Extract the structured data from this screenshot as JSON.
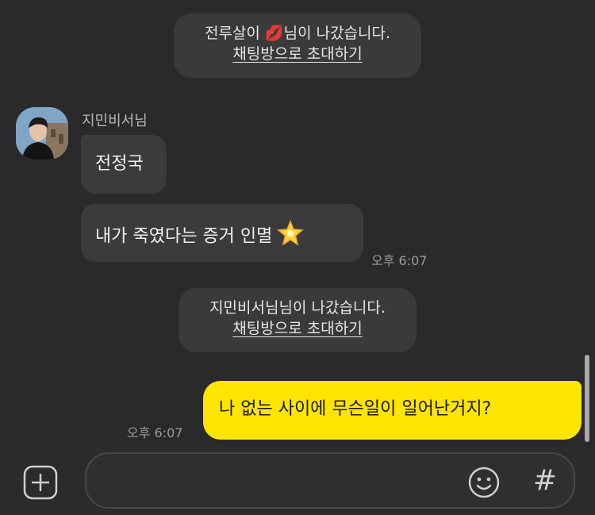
{
  "system_notices": [
    {
      "text": "전루살이 💋님이 나갔습니다.",
      "link": "채팅방으로 초대하기"
    },
    {
      "text": "지민비서님님이 나갔습니다.",
      "link": "채팅방으로 초대하기"
    }
  ],
  "incoming": {
    "sender": "지민비서님",
    "messages": [
      "전정국",
      "내가 죽였다는 증거 인멸"
    ],
    "time": "오후 6:07"
  },
  "outgoing": {
    "message": "나 없는 사이에 무슨일이 일어난거지?",
    "time": "오후 6:07"
  },
  "composer": {
    "placeholder": "",
    "hash_label": "#"
  },
  "icons": [
    "kiss-mark-icon",
    "glowing-star-icon",
    "plus-icon",
    "emoji-icon",
    "hash-icon"
  ],
  "colors": {
    "outgoing_bubble": "#fee500",
    "incoming_bubble": "#3b3b3e",
    "background": "#2a2a2c"
  }
}
